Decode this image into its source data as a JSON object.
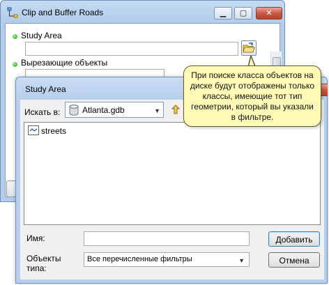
{
  "main_window": {
    "title": "Clip and Buffer Roads",
    "params": [
      {
        "label": "Study Area",
        "value": ""
      },
      {
        "label": "Вырезающие объекты",
        "value": ""
      }
    ],
    "icons": {
      "app": "model-icon",
      "browse": "open-folder-icon"
    }
  },
  "dialog": {
    "title": "Study Area",
    "look_in_label": "Искать в:",
    "look_in_value": "Atlanta.gdb",
    "items": [
      {
        "name": "streets",
        "icon": "line-feature-class-icon"
      }
    ],
    "name_label": "Имя:",
    "name_value": "",
    "type_label": "Объекты типа:",
    "type_value": "Все перечисленные фильтры",
    "add_button": "Добавить",
    "cancel_button": "Отмена"
  },
  "callout": {
    "text": "При поиске класса объектов на диске будут отображены только классы, имеющие тот тип геометрии, который вы указали в фильтре."
  },
  "colors": {
    "title_bar": "#b7cfec",
    "callout_bg": "#fffbb7",
    "required_dot": "#1da314"
  }
}
